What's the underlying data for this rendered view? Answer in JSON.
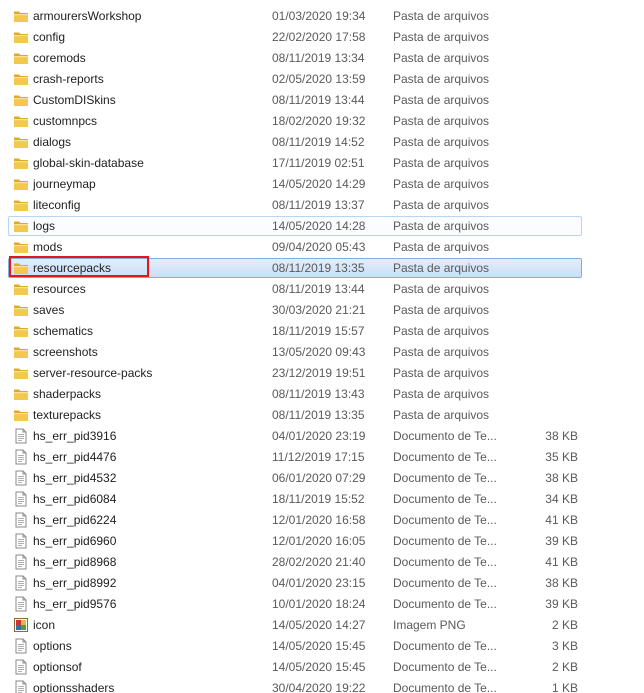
{
  "icons": {
    "folder": "folder-icon",
    "text_file": "text-file-icon",
    "image_file": "png-image-icon"
  },
  "colors": {
    "folder": "#f2c94c",
    "selection_border": "#84acdd",
    "hover_border": "#b8d6f0",
    "highlight_box": "#e8141b"
  },
  "rows": [
    {
      "name": "armourersWorkshop",
      "date": "01/03/2020 19:34",
      "type": "Pasta de arquivos",
      "size": "",
      "icon": "folder"
    },
    {
      "name": "config",
      "date": "22/02/2020 17:58",
      "type": "Pasta de arquivos",
      "size": "",
      "icon": "folder"
    },
    {
      "name": "coremods",
      "date": "08/11/2019 13:34",
      "type": "Pasta de arquivos",
      "size": "",
      "icon": "folder"
    },
    {
      "name": "crash-reports",
      "date": "02/05/2020 13:59",
      "type": "Pasta de arquivos",
      "size": "",
      "icon": "folder"
    },
    {
      "name": "CustomDISkins",
      "date": "08/11/2019 13:44",
      "type": "Pasta de arquivos",
      "size": "",
      "icon": "folder"
    },
    {
      "name": "customnpcs",
      "date": "18/02/2020 19:32",
      "type": "Pasta de arquivos",
      "size": "",
      "icon": "folder"
    },
    {
      "name": "dialogs",
      "date": "08/11/2019 14:52",
      "type": "Pasta de arquivos",
      "size": "",
      "icon": "folder"
    },
    {
      "name": "global-skin-database",
      "date": "17/11/2019 02:51",
      "type": "Pasta de arquivos",
      "size": "",
      "icon": "folder"
    },
    {
      "name": "journeymap",
      "date": "14/05/2020 14:29",
      "type": "Pasta de arquivos",
      "size": "",
      "icon": "folder"
    },
    {
      "name": "liteconfig",
      "date": "08/11/2019 13:37",
      "type": "Pasta de arquivos",
      "size": "",
      "icon": "folder"
    },
    {
      "name": "logs",
      "date": "14/05/2020 14:28",
      "type": "Pasta de arquivos",
      "size": "",
      "icon": "folder",
      "state": "hover"
    },
    {
      "name": "mods",
      "date": "09/04/2020 05:43",
      "type": "Pasta de arquivos",
      "size": "",
      "icon": "folder"
    },
    {
      "name": "resourcepacks",
      "date": "08/11/2019 13:35",
      "type": "Pasta de arquivos",
      "size": "",
      "icon": "folder",
      "state": "selected"
    },
    {
      "name": "resources",
      "date": "08/11/2019 13:44",
      "type": "Pasta de arquivos",
      "size": "",
      "icon": "folder"
    },
    {
      "name": "saves",
      "date": "30/03/2020 21:21",
      "type": "Pasta de arquivos",
      "size": "",
      "icon": "folder"
    },
    {
      "name": "schematics",
      "date": "18/11/2019 15:57",
      "type": "Pasta de arquivos",
      "size": "",
      "icon": "folder"
    },
    {
      "name": "screenshots",
      "date": "13/05/2020 09:43",
      "type": "Pasta de arquivos",
      "size": "",
      "icon": "folder"
    },
    {
      "name": "server-resource-packs",
      "date": "23/12/2019 19:51",
      "type": "Pasta de arquivos",
      "size": "",
      "icon": "folder"
    },
    {
      "name": "shaderpacks",
      "date": "08/11/2019 13:43",
      "type": "Pasta de arquivos",
      "size": "",
      "icon": "folder"
    },
    {
      "name": "texturepacks",
      "date": "08/11/2019 13:35",
      "type": "Pasta de arquivos",
      "size": "",
      "icon": "folder"
    },
    {
      "name": "hs_err_pid3916",
      "date": "04/01/2020 23:19",
      "type": "Documento de Te...",
      "size": "38 KB",
      "icon": "text_file"
    },
    {
      "name": "hs_err_pid4476",
      "date": "11/12/2019 17:15",
      "type": "Documento de Te...",
      "size": "35 KB",
      "icon": "text_file"
    },
    {
      "name": "hs_err_pid4532",
      "date": "06/01/2020 07:29",
      "type": "Documento de Te...",
      "size": "38 KB",
      "icon": "text_file"
    },
    {
      "name": "hs_err_pid6084",
      "date": "18/11/2019 15:52",
      "type": "Documento de Te...",
      "size": "34 KB",
      "icon": "text_file"
    },
    {
      "name": "hs_err_pid6224",
      "date": "12/01/2020 16:58",
      "type": "Documento de Te...",
      "size": "41 KB",
      "icon": "text_file"
    },
    {
      "name": "hs_err_pid6960",
      "date": "12/01/2020 16:05",
      "type": "Documento de Te...",
      "size": "39 KB",
      "icon": "text_file"
    },
    {
      "name": "hs_err_pid8968",
      "date": "28/02/2020 21:40",
      "type": "Documento de Te...",
      "size": "41 KB",
      "icon": "text_file"
    },
    {
      "name": "hs_err_pid8992",
      "date": "04/01/2020 23:15",
      "type": "Documento de Te...",
      "size": "38 KB",
      "icon": "text_file"
    },
    {
      "name": "hs_err_pid9576",
      "date": "10/01/2020 18:24",
      "type": "Documento de Te...",
      "size": "39 KB",
      "icon": "text_file"
    },
    {
      "name": "icon",
      "date": "14/05/2020 14:27",
      "type": "Imagem PNG",
      "size": "2 KB",
      "icon": "image_file"
    },
    {
      "name": "options",
      "date": "14/05/2020 15:45",
      "type": "Documento de Te...",
      "size": "3 KB",
      "icon": "text_file"
    },
    {
      "name": "optionsof",
      "date": "14/05/2020 15:45",
      "type": "Documento de Te...",
      "size": "2 KB",
      "icon": "text_file"
    },
    {
      "name": "optionsshaders",
      "date": "30/04/2020 19:22",
      "type": "Documento de Te...",
      "size": "1 KB",
      "icon": "text_file"
    }
  ]
}
